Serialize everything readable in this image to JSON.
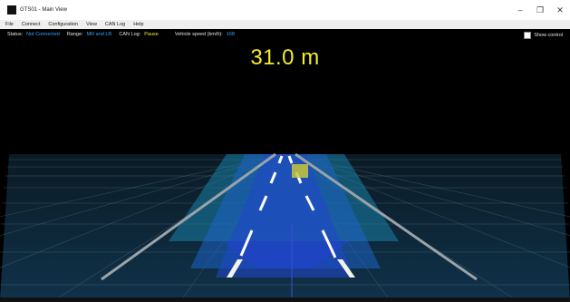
{
  "window": {
    "title": "GTS01 - Main View",
    "minimize": "–",
    "maximize": "❐",
    "close": "✕"
  },
  "menu": [
    "File",
    "Connect",
    "Configuration",
    "View",
    "CAN Log",
    "Help"
  ],
  "status": {
    "status_label": "Status:",
    "status_value": "Not Connected",
    "range_label": "Range:",
    "range_value": "MR and LR",
    "canlog_label": "CAN Log:",
    "canlog_value": "Pause",
    "speed_label": "Vehicle speed (km/h):",
    "speed_value": "168"
  },
  "show_control_label": "Show control",
  "distance_readout": "31.0 m",
  "colors": {
    "status_value": "#3aa0ff",
    "canlog_value": "#f3e84a",
    "distance": "#f3ef2a",
    "beam": "#1d63c7",
    "target": "#c9c53a"
  }
}
